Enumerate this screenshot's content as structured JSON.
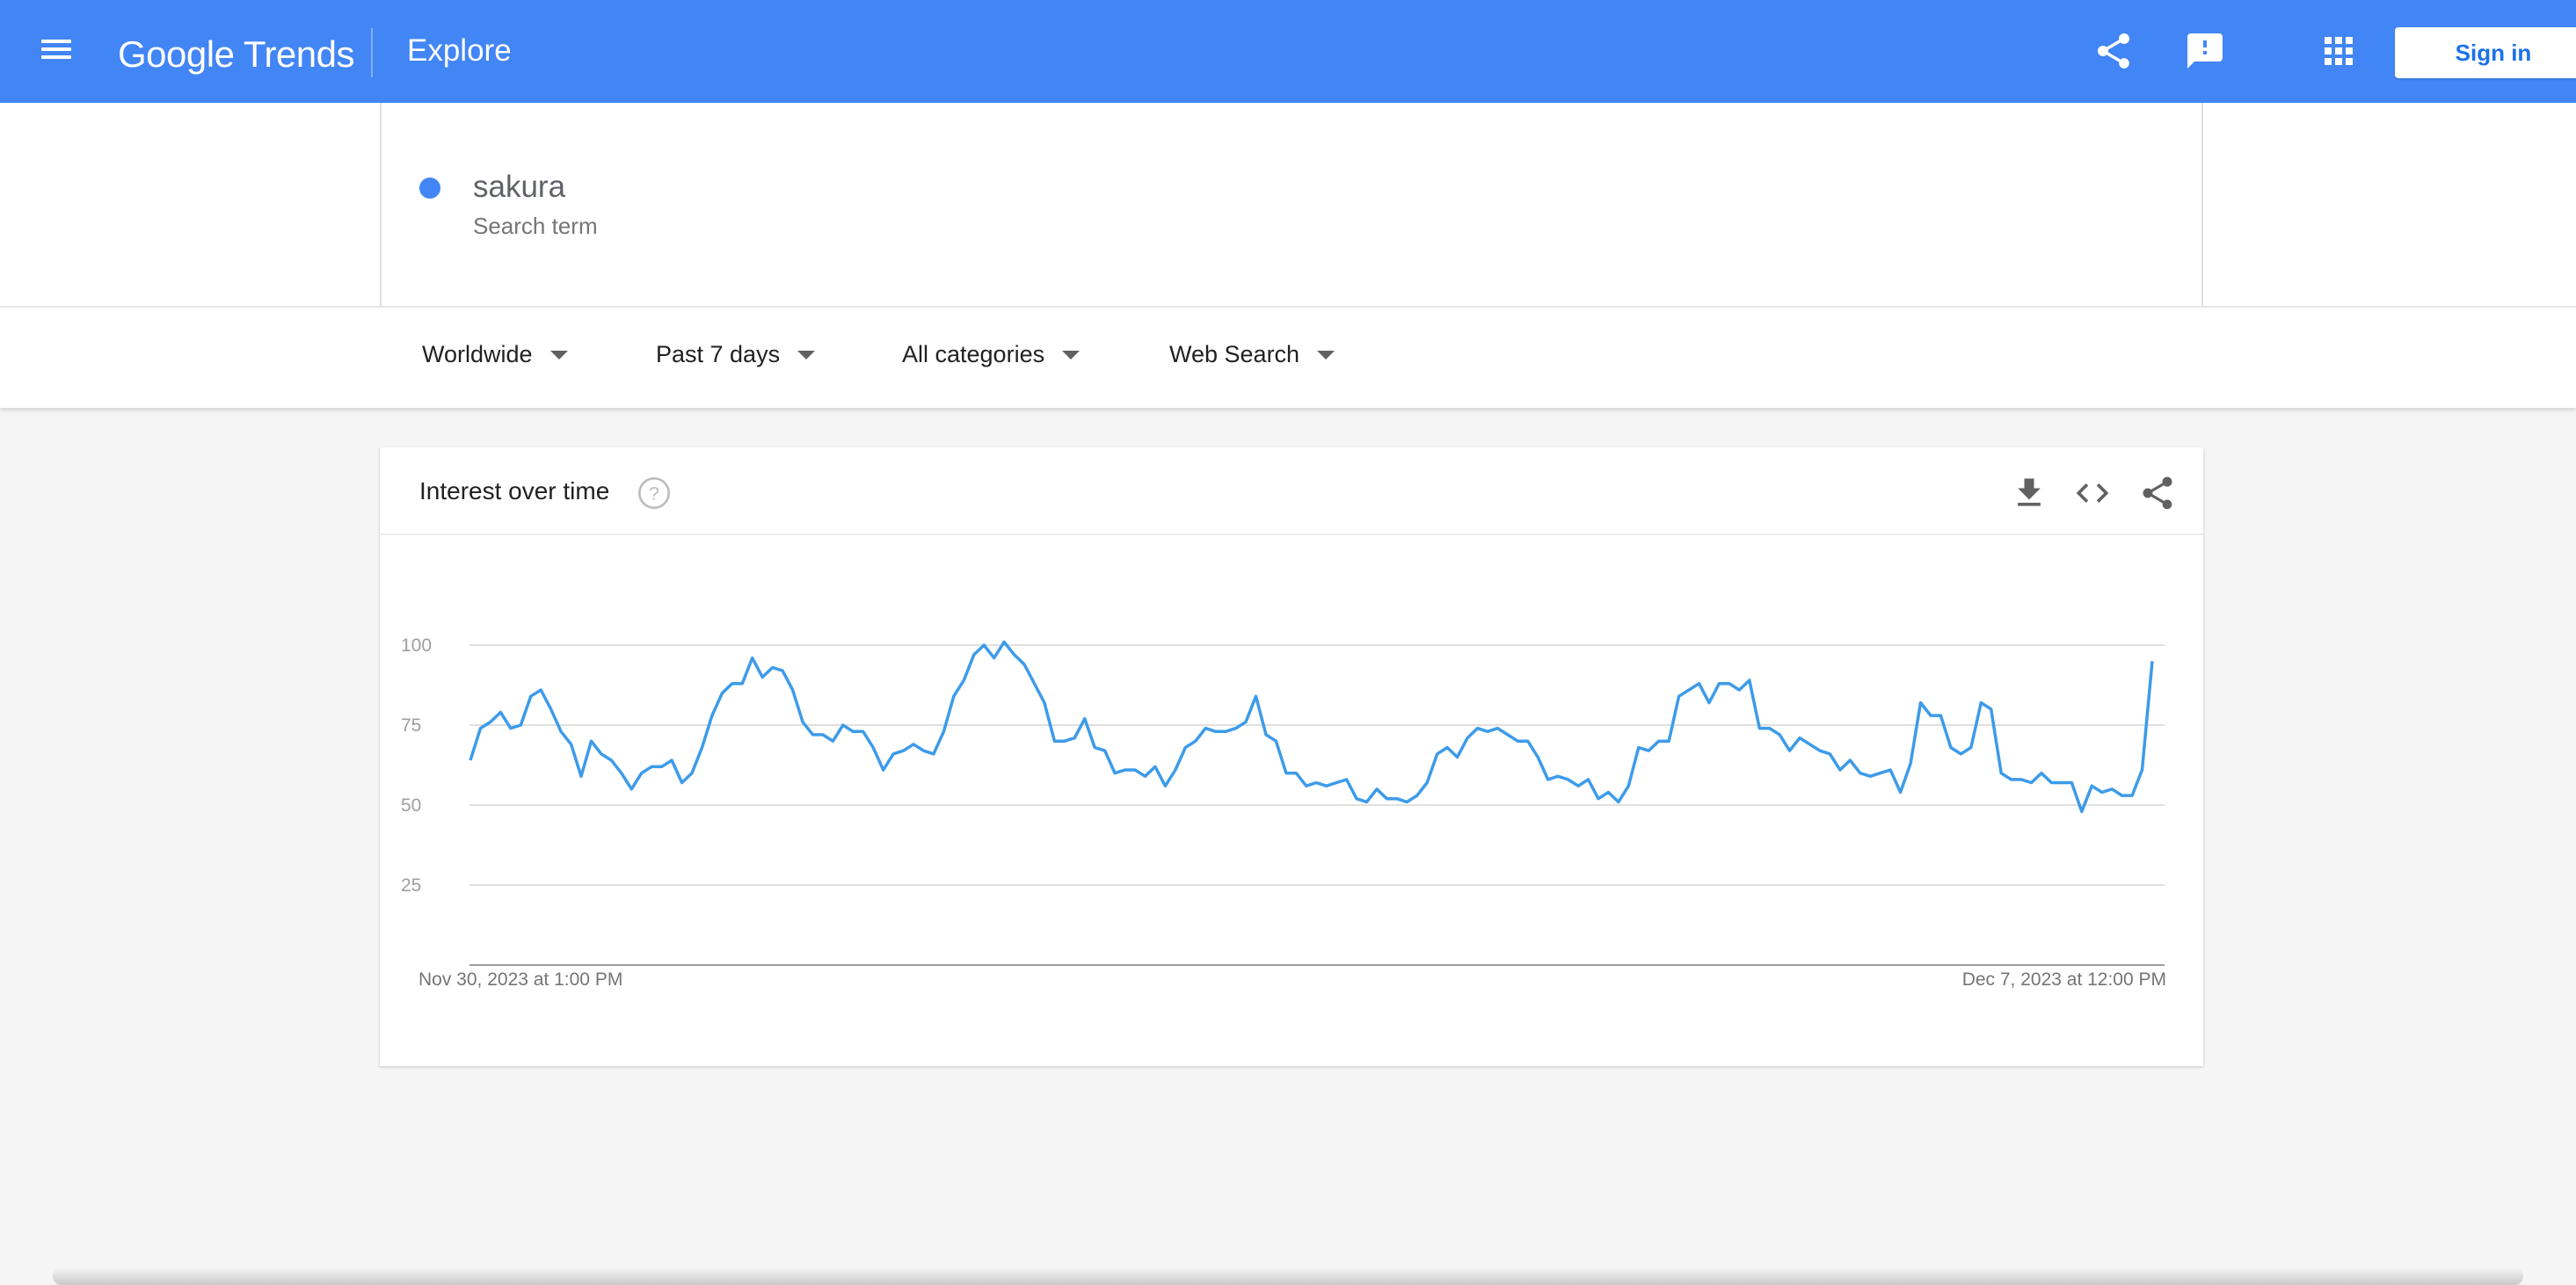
{
  "header": {
    "logo": "Google Trends",
    "page": "Explore",
    "signin_label": "Sign in",
    "icons": [
      "menu-icon",
      "share-icon",
      "feedback-icon",
      "apps-icon"
    ],
    "brand_color": "#4285f4"
  },
  "term": {
    "name": "sakura",
    "type": "Search term",
    "color": "#4285f4"
  },
  "filters": {
    "geo": "Worldwide",
    "time": "Past 7 days",
    "category": "All categories",
    "property": "Web Search"
  },
  "card": {
    "title": "Interest over time",
    "icons": [
      "help-icon",
      "download-icon",
      "embed-icon",
      "share-icon"
    ]
  },
  "chart_data": {
    "type": "line",
    "title": "",
    "xlabel": "",
    "ylabel": "",
    "ylim": [
      0,
      100
    ],
    "yticks": [
      "25",
      "50",
      "75",
      "100"
    ],
    "x_start_label": "Nov 30, 2023 at 1:00 PM",
    "x_end_label": "Dec 7, 2023 at 12:00 PM",
    "grid": true,
    "series": [
      {
        "color": "#3d9be9",
        "values": [
          64,
          74,
          76,
          79,
          74,
          75,
          84,
          86,
          80,
          73,
          69,
          59,
          70,
          66,
          64,
          60,
          55,
          60,
          62,
          62,
          64,
          57,
          60,
          68,
          78,
          85,
          88,
          88,
          96,
          90,
          93,
          92,
          86,
          76,
          72,
          72,
          70,
          75,
          73,
          73,
          68,
          61,
          66,
          67,
          69,
          67,
          66,
          73,
          84,
          89,
          97,
          100,
          96,
          101,
          97,
          94,
          88,
          82,
          70,
          70,
          71,
          77,
          68,
          67,
          60,
          61,
          61,
          59,
          62,
          56,
          61,
          68,
          70,
          74,
          73,
          73,
          74,
          76,
          84,
          72,
          70,
          60,
          60,
          56,
          57,
          56,
          57,
          58,
          52,
          51,
          55,
          52,
          52,
          51,
          53,
          57,
          66,
          68,
          65,
          71,
          74,
          73,
          74,
          72,
          70,
          70,
          65,
          58,
          59,
          58,
          56,
          58,
          52,
          54,
          51,
          56,
          68,
          67,
          70,
          70,
          84,
          86,
          88,
          82,
          88,
          88,
          86,
          89,
          74,
          74,
          72,
          67,
          71,
          69,
          67,
          66,
          61,
          64,
          60,
          59,
          60,
          61,
          54,
          63,
          82,
          78,
          78,
          68,
          66,
          68,
          82,
          80,
          60,
          58,
          58,
          57,
          60,
          57,
          57,
          57,
          48,
          56,
          54,
          55,
          53,
          53,
          61,
          95
        ]
      }
    ]
  }
}
